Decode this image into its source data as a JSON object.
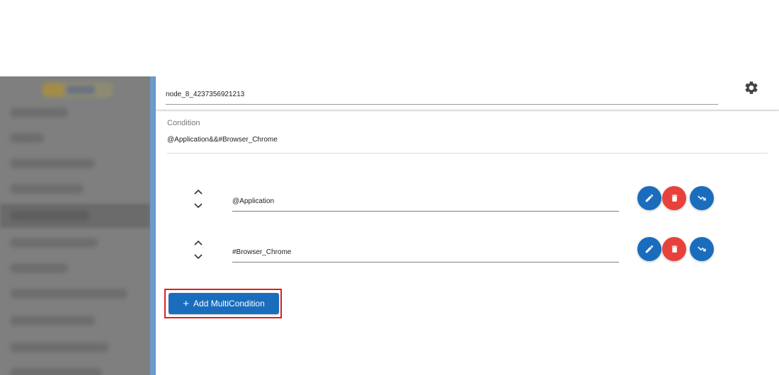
{
  "node": {
    "name": "node_8_4237356921213"
  },
  "condition": {
    "label": "Condition",
    "expression": "@Application&&#Browser_Chrome"
  },
  "multi_conditions": [
    {
      "value": "@Application"
    },
    {
      "value": "#Browser_Chrome"
    }
  ],
  "actions": {
    "add_label": "Add MultiCondition",
    "add_icon": "+"
  },
  "icons": {
    "settings": "gear-icon",
    "move_up": "chevron-up-icon",
    "move_down": "chevron-down-icon",
    "edit": "pencil-icon",
    "delete": "trash-icon",
    "navigate": "trend-arrow-icon"
  },
  "colors": {
    "primary": "#1a6dbd",
    "danger": "#e8413c",
    "highlight_border": "#e0201e",
    "sidebar_overlay": "#7f7f7f"
  }
}
